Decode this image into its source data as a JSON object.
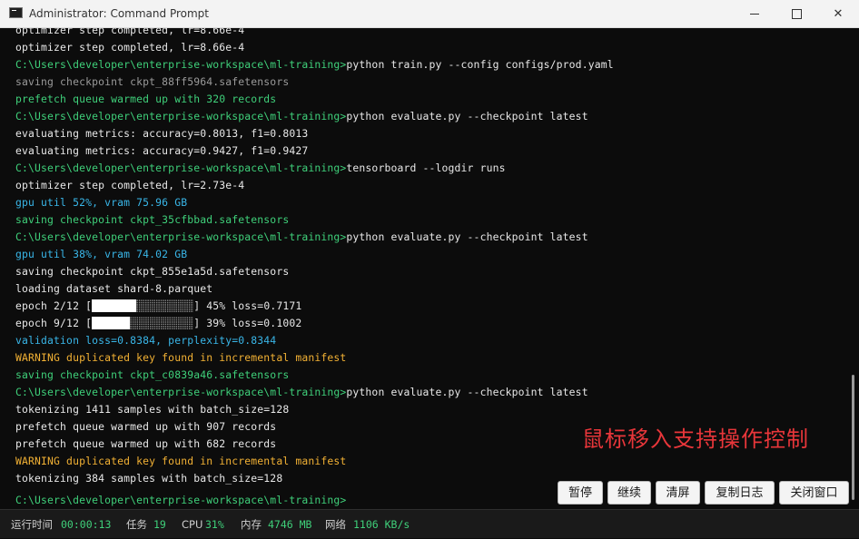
{
  "window": {
    "title": "Administrator: Command Prompt",
    "minimize_icon": "minimize-icon",
    "maximize_icon": "maximize-icon",
    "close_icon": "close-icon"
  },
  "terminal": {
    "lines": [
      {
        "text": "optimizer step completed, lr=8.66e-4",
        "style": "white"
      },
      {
        "prompt": "C:\\Users\\developer\\enterprise-workspace\\ml-training>",
        "cmd": "python train.py --config configs/prod.yaml"
      },
      {
        "text": "saving checkpoint ckpt_88ff5964.safetensors",
        "style": "gray"
      },
      {
        "text": "prefetch queue warmed up with 320 records",
        "style": "green"
      },
      {
        "prompt": "C:\\Users\\developer\\enterprise-workspace\\ml-training>",
        "cmd": "python evaluate.py --checkpoint latest"
      },
      {
        "text": "evaluating metrics: accuracy=0.8013, f1=0.8013",
        "style": "white"
      },
      {
        "text": "evaluating metrics: accuracy=0.9427, f1=0.9427",
        "style": "white"
      },
      {
        "prompt": "C:\\Users\\developer\\enterprise-workspace\\ml-training>",
        "cmd": "tensorboard --logdir runs"
      },
      {
        "text": "optimizer step completed, lr=2.73e-4",
        "style": "white"
      },
      {
        "text": "gpu util 52%, vram 75.96 GB",
        "style": "cyan"
      },
      {
        "text": "saving checkpoint ckpt_35cfbbad.safetensors",
        "style": "green"
      },
      {
        "prompt": "C:\\Users\\developer\\enterprise-workspace\\ml-training>",
        "cmd": "python evaluate.py --checkpoint latest"
      },
      {
        "text": "gpu util 38%, vram 74.02 GB",
        "style": "cyan"
      },
      {
        "text": "saving checkpoint ckpt_855e1a5d.safetensors",
        "style": "white"
      },
      {
        "text": "loading dataset shard-8.parquet",
        "style": "white"
      },
      {
        "progress": true,
        "prefix": "epoch 2/12 [",
        "fraction": 0.45,
        "suffix": "] 45% loss=0.7171"
      },
      {
        "progress": true,
        "prefix": "epoch 9/12 [",
        "fraction": 0.39,
        "suffix": "] 39% loss=0.1002"
      },
      {
        "text": "validation loss=0.8384, perplexity=0.8344",
        "style": "cyan"
      },
      {
        "text": "WARNING duplicated key found in incremental manifest",
        "style": "yellow"
      },
      {
        "text": "saving checkpoint ckpt_c0839a46.safetensors",
        "style": "green"
      },
      {
        "prompt": "C:\\Users\\developer\\enterprise-workspace\\ml-training>",
        "cmd": "python evaluate.py --checkpoint latest"
      },
      {
        "text": "tokenizing 1411 samples with batch_size=128",
        "style": "white"
      },
      {
        "text": "prefetch queue warmed up with 907 records",
        "style": "white"
      },
      {
        "text": "prefetch queue warmed up with 682 records",
        "style": "white"
      },
      {
        "text": "WARNING duplicated key found in incremental manifest",
        "style": "yellow"
      },
      {
        "text": "tokenizing 384 samples with batch_size=128",
        "style": "white"
      }
    ],
    "current_prompt": "C:\\Users\\developer\\enterprise-workspace\\ml-training>"
  },
  "overlay": {
    "hint": "鼠标移入支持操作控制",
    "hint_color": "#e8363a",
    "buttons": {
      "pause": "暂停",
      "resume": "继续",
      "clear": "清屏",
      "copy_log": "复制日志",
      "close_window": "关闭窗口"
    }
  },
  "status": {
    "runtime_label": "运行时间",
    "runtime_value": "00:00:13",
    "tasks_label": "任务",
    "tasks_value": "19",
    "cpu_label": "CPU",
    "cpu_value": "31%",
    "mem_label": "内存",
    "mem_value": "4746 MB",
    "net_label": "网络",
    "net_value": "1106 KB/s"
  },
  "colors": {
    "prompt": "#3fd07a",
    "info_cyan": "#39b6e8",
    "warning": "#f2b134",
    "status_value": "#3fd07a"
  }
}
